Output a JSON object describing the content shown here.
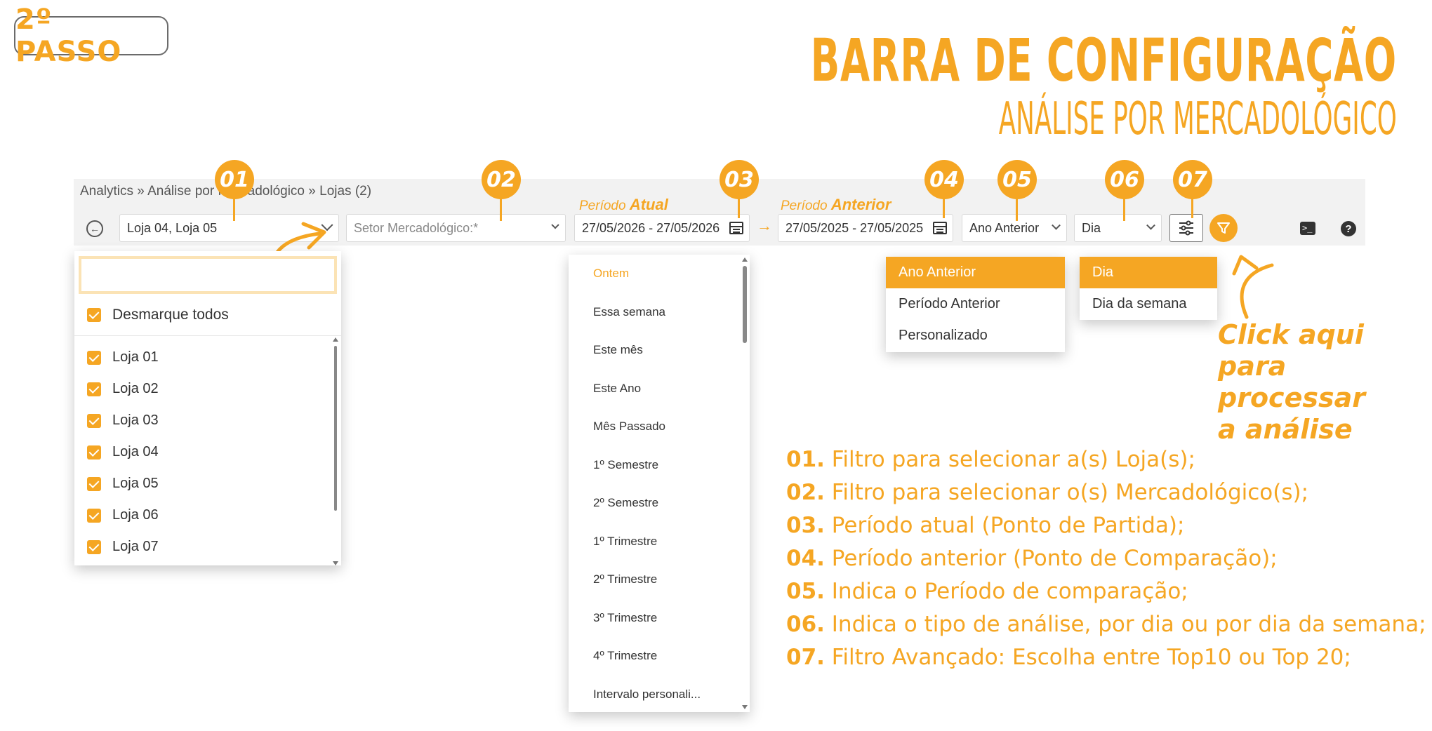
{
  "step_badge": "2º PASSO",
  "title_line1": "BARRA DE CONFIGURAÇÃO",
  "title_line2": "ANÁLISE POR MERCADOLÓGICO",
  "breadcrumb": "Analytics » Análise por Mercadológico » Lojas (2)",
  "badges": [
    "01",
    "02",
    "03",
    "04",
    "05",
    "06",
    "07"
  ],
  "toolbar": {
    "stores_value": "Loja 04, Loja 05",
    "sector_placeholder": "Setor Mercadológico:*",
    "current_period_label_prefix": "Período",
    "current_period_label_strong": "Atual",
    "current_period_value": "27/05/2026 - 27/05/2026",
    "previous_period_label_prefix": "Período",
    "previous_period_label_strong": "Anterior",
    "previous_period_value": "27/05/2025 - 27/05/2025",
    "comparison_value": "Ano Anterior",
    "analysis_type_value": "Dia"
  },
  "store_dropdown": {
    "search_value": "",
    "toggle_all_label": "Desmarque todos",
    "items": [
      "Loja 01",
      "Loja 02",
      "Loja 03",
      "Loja 04",
      "Loja 05",
      "Loja 06",
      "Loja 07"
    ]
  },
  "period_dropdown": {
    "items": [
      "Ontem",
      "Essa semana",
      "Este mês",
      "Este Ano",
      "Mês Passado",
      "1º Semestre",
      "2º Semestre",
      "1º Trimestre",
      "2º Trimestre",
      "3º Trimestre",
      "4º Trimestre",
      "Intervalo personali..."
    ]
  },
  "comparison_dropdown": {
    "items": [
      "Ano Anterior",
      "Período Anterior",
      "Personalizado"
    ]
  },
  "analysis_dropdown": {
    "items": [
      "Dia",
      "Dia da semana"
    ]
  },
  "click_hint": [
    "Click aqui",
    "para processar",
    "a análise"
  ],
  "legend": [
    {
      "num": "01.",
      "text": "Filtro para selecionar a(s) Loja(s);"
    },
    {
      "num": "02.",
      "text": "Filtro para selecionar o(s) Mercadológico(s);"
    },
    {
      "num": "03.",
      "text": "Período atual (Ponto de Partida);"
    },
    {
      "num": "04.",
      "text": "Período anterior (Ponto de Comparação);"
    },
    {
      "num": "05.",
      "text": "Indica o Período de comparação;"
    },
    {
      "num": "06.",
      "text": "Indica o tipo de análise, por dia ou por dia da semana;"
    },
    {
      "num": "07.",
      "text": "Filtro Avançado: Escolha entre Top10 ou Top 20;"
    }
  ],
  "colors": {
    "accent": "#f5a623",
    "toolbar_bg": "#f2f2f2"
  }
}
